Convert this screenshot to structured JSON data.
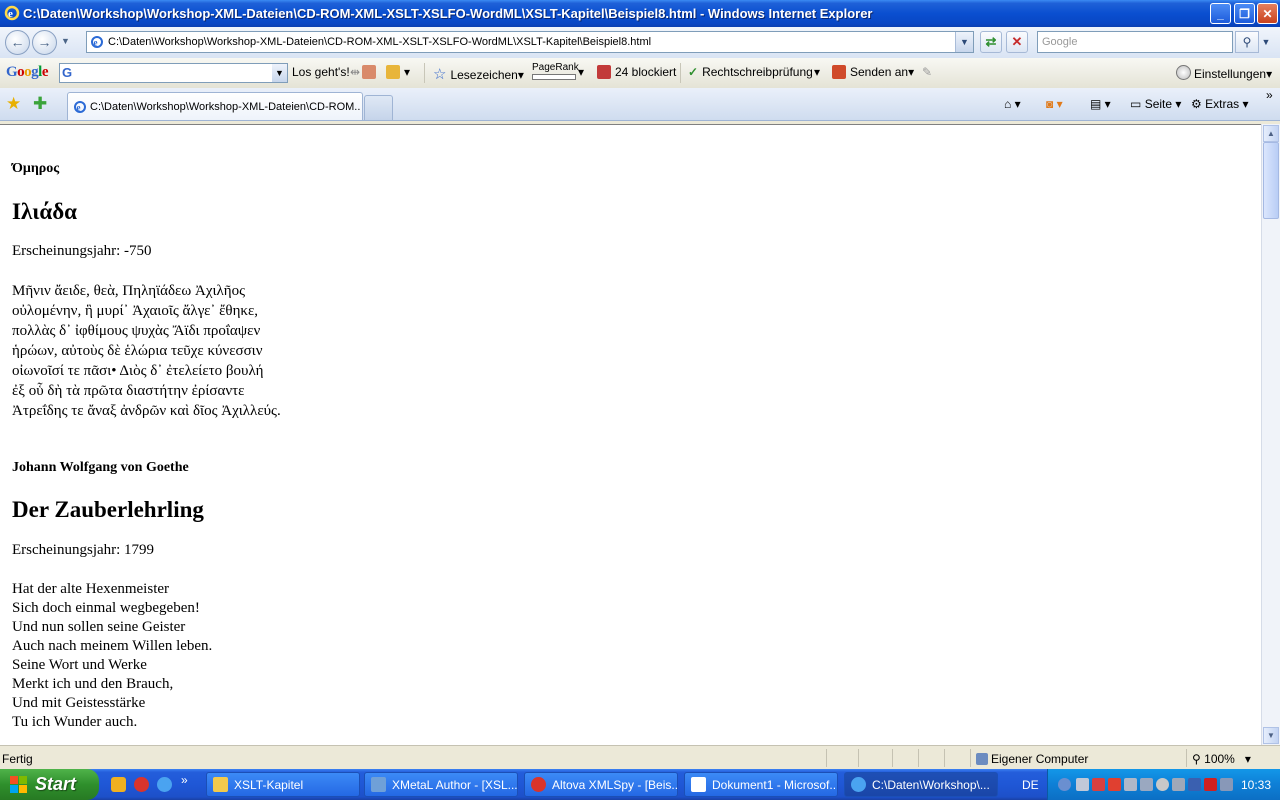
{
  "window": {
    "title": "C:\\Daten\\Workshop\\Workshop-XML-Dateien\\CD-ROM-XML-XSLT-XSLFO-WordML\\XSLT-Kapitel\\Beispiel8.html - Windows Internet Explorer"
  },
  "addressbar": {
    "url": "C:\\Daten\\Workshop\\Workshop-XML-Dateien\\CD-ROM-XML-XSLT-XSLFO-WordML\\XSLT-Kapitel\\Beispiel8.html",
    "search_placeholder": "Google"
  },
  "google_toolbar": {
    "logo": "Google",
    "go_label": "Los geht's!",
    "bookmarks_label": "Lesezeichen",
    "pagerank_label": "PageRank",
    "blocked_label": "24 blockiert",
    "spellcheck_label": "Rechtschreibprüfung",
    "send_label": "Senden an",
    "settings_label": "Einstellungen"
  },
  "tabs": {
    "active_label": "C:\\Daten\\Workshop\\Workshop-XML-Dateien\\CD-ROM...",
    "page_label": "Seite",
    "extras_label": "Extras"
  },
  "document": {
    "entries": [
      {
        "author": "Όμηρος",
        "title": "Ιλιάδα",
        "year": "Erscheinungsjahr: -750",
        "lines": [
          "Μῆνιν ἄειδε, θεὰ, Πηληϊάδεω Ἀχιλῆος",
          "οὐλομένην, ἣ μυρί᾽ Ἀχαιοῖς ἄλγε᾽ ἔθηκε,",
          "πολλὰς δ᾽ ἰφθίμους ψυχὰς Ἄϊδι προΐαψεν",
          "ἡρώων, αὐτοὺς δὲ ἑλώρια τεῦχε κύνεσσιν",
          "οἰωνοῖσί τε πᾶσι• Διὸς δ᾽ ἐτελείετο βουλή",
          "ἐξ οὗ δὴ τὰ πρῶτα διαστήτην ἐρίσαντε",
          "Ἀτρεΐδης τε ἄναξ ἀνδρῶν καὶ δῖος Ἀχιλλεύς."
        ]
      },
      {
        "author": "Johann Wolfgang von Goethe",
        "title": "Der Zauberlehrling",
        "year": "Erscheinungsjahr: 1799",
        "lines": [
          "Hat der alte Hexenmeister",
          "Sich doch einmal wegbegeben!",
          "Und nun sollen seine Geister",
          "Auch nach meinem Willen leben.",
          "Seine Wort und Werke",
          "Merkt ich und den Brauch,",
          "Und mit Geistesstärke",
          "Tu ich Wunder auch."
        ]
      }
    ]
  },
  "statusbar": {
    "status": "Fertig",
    "zone": "Eigener Computer",
    "zoom": "100%"
  },
  "taskbar": {
    "start_label": "Start",
    "items": [
      {
        "label": "XSLT-Kapitel"
      },
      {
        "label": "XMetaL Author - [XSL..."
      },
      {
        "label": "Altova XMLSpy - [Beis..."
      },
      {
        "label": "Dokument1 - Microsof..."
      },
      {
        "label": "C:\\Daten\\Workshop\\..."
      }
    ],
    "language": "DE",
    "clock": "10:33"
  },
  "colors": {
    "titlebar": "#0a4fd0",
    "taskbar": "#245edb",
    "start": "#2f8f2c",
    "tray": "#0e7fd6"
  }
}
